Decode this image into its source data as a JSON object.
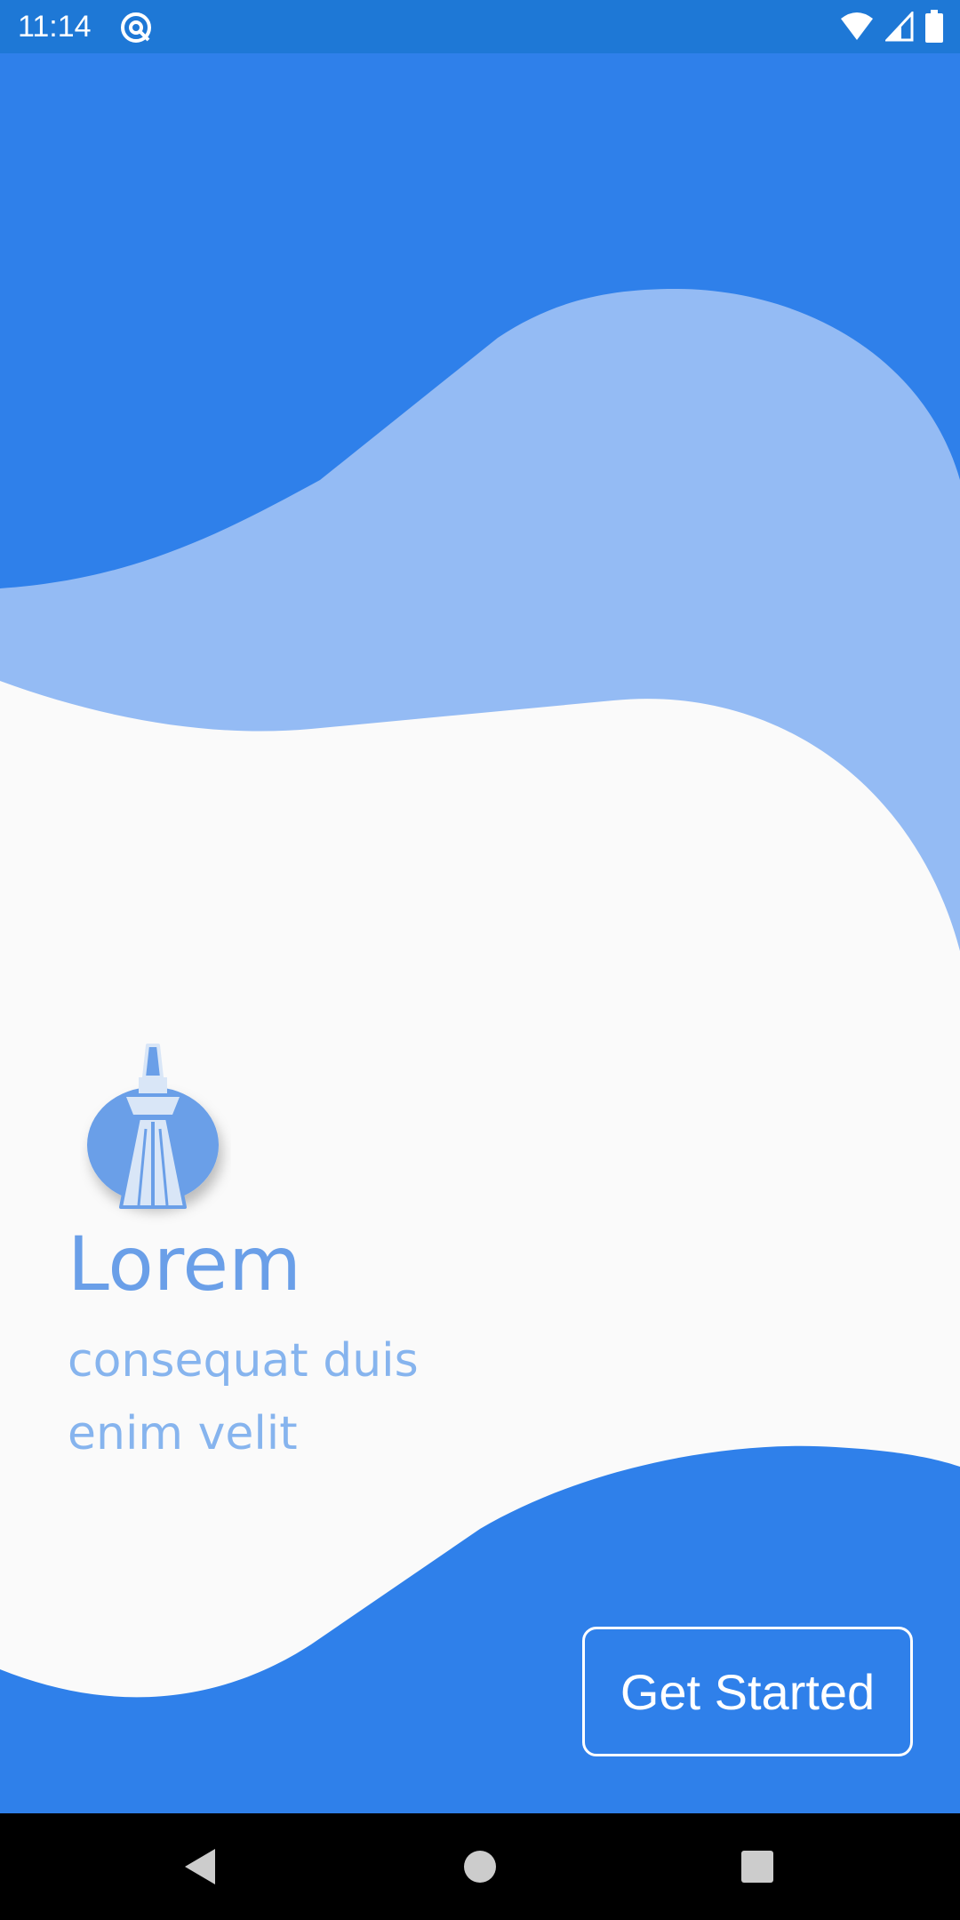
{
  "status_bar": {
    "time": "11:14",
    "icons": [
      "notification-icon",
      "wifi-icon",
      "signal-icon",
      "battery-icon"
    ]
  },
  "onboarding": {
    "title": "Lorem",
    "subtitle_line1": "consequat duis",
    "subtitle_line2": "enim velit",
    "cta_label": "Get Started",
    "logo_icon": "tower-icon"
  },
  "navigation": {
    "icons": [
      "back-icon",
      "home-icon",
      "recents-icon"
    ]
  },
  "colors": {
    "primary": "#2f80ea",
    "light_wave": "#94bbf4",
    "background": "#fafafa",
    "status_bar": "#1e78d6",
    "title_text": "#6a9fe8",
    "subtitle_text": "#86b4ee"
  }
}
